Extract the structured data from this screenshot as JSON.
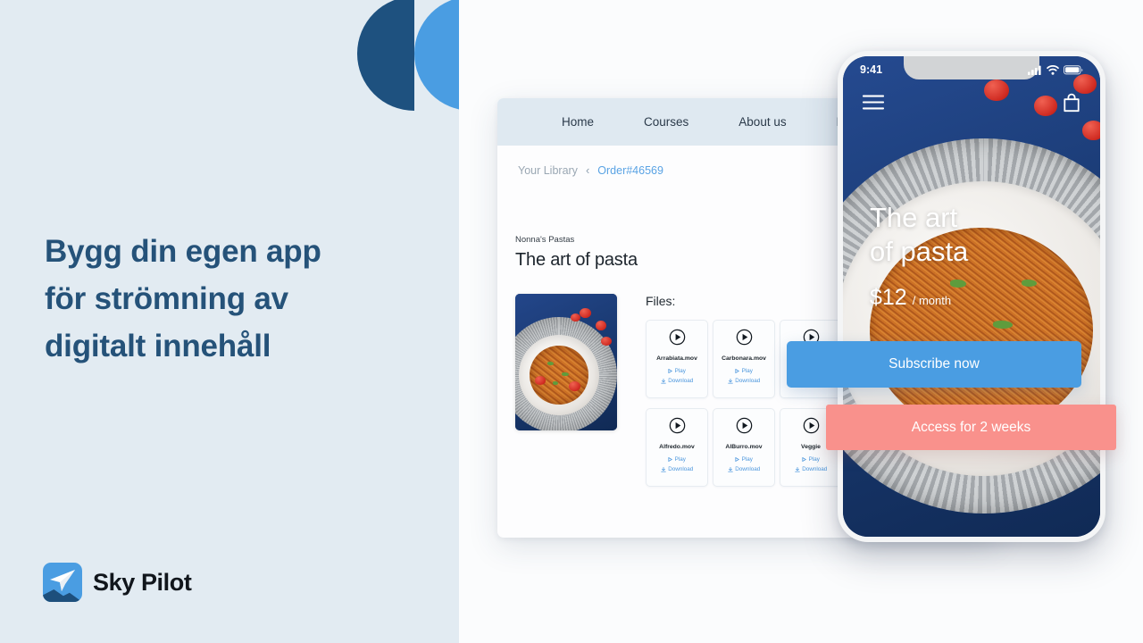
{
  "colors": {
    "left_panel_bg": "#e2ebf2",
    "headline": "#255279",
    "accent_blue": "#4a9de2",
    "accent_navy": "#1e517f",
    "accent_salmon": "#f9918c",
    "link_blue": "#4b96dd"
  },
  "left": {
    "headline_lines": [
      "Bygg din egen app",
      "för strömning av",
      "digitalt innehåll"
    ],
    "brand_name": "Sky Pilot",
    "logo_icon": "paper-plane-mountain-icon"
  },
  "browser": {
    "nav_items": [
      {
        "label": "Home"
      },
      {
        "label": "Courses"
      },
      {
        "label": "About us"
      },
      {
        "label": "Books"
      }
    ],
    "breadcrumb": {
      "parent": "Your Library",
      "chevron": "‹",
      "current": "Order#46569"
    },
    "course": {
      "kicker": "Nonna's Pastas",
      "title": "The art of pasta",
      "thumbnail_alt": "pasta-dish-photo"
    },
    "files_label": "Files:",
    "file_actions": {
      "play": "Play",
      "download": "Download"
    },
    "files": [
      {
        "name": "Arrabiata.mov"
      },
      {
        "name": "Carbonara.mov"
      },
      {
        "name": ""
      },
      {
        "name": "Alfredo.mov"
      },
      {
        "name": "AlBurro.mov"
      },
      {
        "name": "Veggie"
      }
    ]
  },
  "phone": {
    "status": {
      "time": "9:41",
      "signal_icon": "cellular-signal-icon",
      "wifi_icon": "wifi-icon",
      "battery_icon": "battery-icon"
    },
    "app_bar": {
      "menu_icon": "hamburger-menu-icon",
      "bag_icon": "shopping-bag-icon"
    },
    "hero_title_lines": [
      "The art",
      "of pasta"
    ],
    "price_amount": "$12",
    "price_period": "/ month"
  },
  "cta": {
    "subscribe_label": "Subscribe now",
    "access_label": "Access for 2 weeks"
  }
}
